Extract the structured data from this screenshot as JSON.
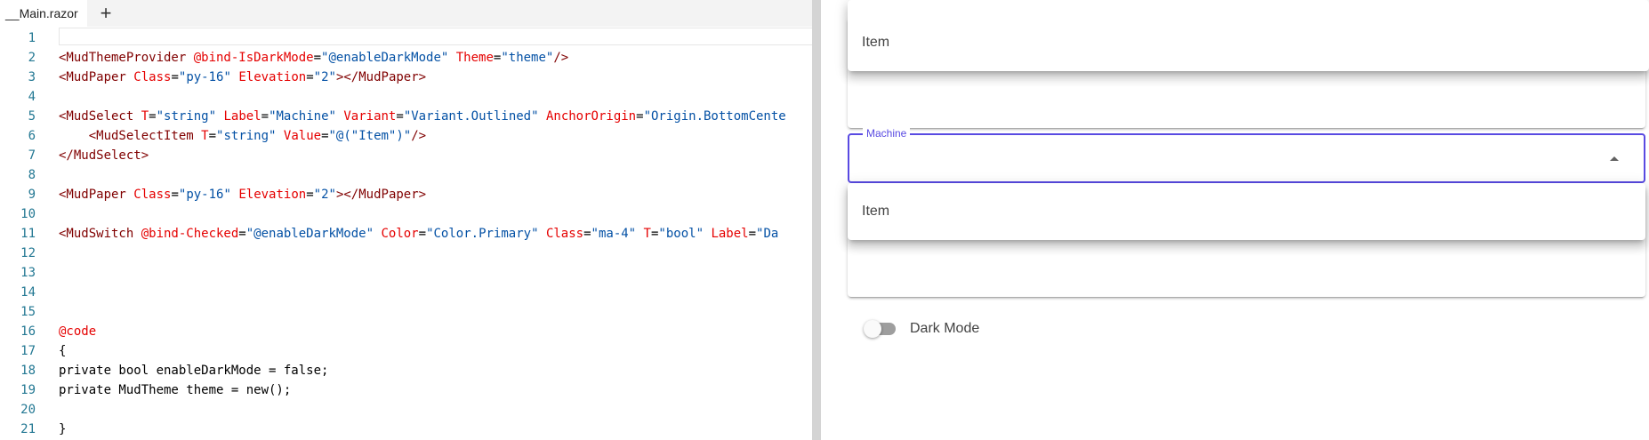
{
  "editor": {
    "tab_label": "__Main.razor",
    "add_tab_symbol": "+",
    "line_numbers": [
      "1",
      "2",
      "3",
      "4",
      "5",
      "6",
      "7",
      "8",
      "9",
      "10",
      "11",
      "12",
      "13",
      "14",
      "15",
      "16",
      "17",
      "18",
      "19",
      "20",
      "21"
    ],
    "lines": [
      [],
      [
        {
          "t": "<MudThemeProvider ",
          "c": "tag"
        },
        {
          "t": "@bind-IsDarkMode",
          "c": "razor"
        },
        {
          "t": "=",
          "c": ""
        },
        {
          "t": "\"@enableDarkMode\"",
          "c": "str"
        },
        {
          "t": " ",
          "c": ""
        },
        {
          "t": "Theme",
          "c": "attr"
        },
        {
          "t": "=",
          "c": ""
        },
        {
          "t": "\"theme\"",
          "c": "str"
        },
        {
          "t": "/>",
          "c": "tag"
        }
      ],
      [
        {
          "t": "<MudPaper ",
          "c": "tag"
        },
        {
          "t": "Class",
          "c": "attr"
        },
        {
          "t": "=",
          "c": ""
        },
        {
          "t": "\"py-16\"",
          "c": "str"
        },
        {
          "t": " ",
          "c": ""
        },
        {
          "t": "Elevation",
          "c": "attr"
        },
        {
          "t": "=",
          "c": ""
        },
        {
          "t": "\"2\"",
          "c": "str"
        },
        {
          "t": "></MudPaper>",
          "c": "tag"
        }
      ],
      [],
      [
        {
          "t": "<MudSelect ",
          "c": "tag"
        },
        {
          "t": "T",
          "c": "attr"
        },
        {
          "t": "=",
          "c": ""
        },
        {
          "t": "\"string\"",
          "c": "str"
        },
        {
          "t": " ",
          "c": ""
        },
        {
          "t": "Label",
          "c": "attr"
        },
        {
          "t": "=",
          "c": ""
        },
        {
          "t": "\"Machine\"",
          "c": "str"
        },
        {
          "t": " ",
          "c": ""
        },
        {
          "t": "Variant",
          "c": "attr"
        },
        {
          "t": "=",
          "c": ""
        },
        {
          "t": "\"Variant.Outlined\"",
          "c": "str"
        },
        {
          "t": " ",
          "c": ""
        },
        {
          "t": "AnchorOrigin",
          "c": "attr"
        },
        {
          "t": "=",
          "c": ""
        },
        {
          "t": "\"Origin.BottomCente",
          "c": "str"
        }
      ],
      [
        {
          "t": "    <MudSelectItem ",
          "c": "tag"
        },
        {
          "t": "T",
          "c": "attr"
        },
        {
          "t": "=",
          "c": ""
        },
        {
          "t": "\"string\"",
          "c": "str"
        },
        {
          "t": " ",
          "c": ""
        },
        {
          "t": "Value",
          "c": "attr"
        },
        {
          "t": "=",
          "c": ""
        },
        {
          "t": "\"@(\"Item\")\"",
          "c": "str"
        },
        {
          "t": "/>",
          "c": "tag"
        }
      ],
      [
        {
          "t": "</MudSelect>",
          "c": "tag"
        }
      ],
      [],
      [
        {
          "t": "<MudPaper ",
          "c": "tag"
        },
        {
          "t": "Class",
          "c": "attr"
        },
        {
          "t": "=",
          "c": ""
        },
        {
          "t": "\"py-16\"",
          "c": "str"
        },
        {
          "t": " ",
          "c": ""
        },
        {
          "t": "Elevation",
          "c": "attr"
        },
        {
          "t": "=",
          "c": ""
        },
        {
          "t": "\"2\"",
          "c": "str"
        },
        {
          "t": "></MudPaper>",
          "c": "tag"
        }
      ],
      [],
      [
        {
          "t": "<MudSwitch ",
          "c": "tag"
        },
        {
          "t": "@bind-Checked",
          "c": "razor"
        },
        {
          "t": "=",
          "c": ""
        },
        {
          "t": "\"@enableDarkMode\"",
          "c": "str"
        },
        {
          "t": " ",
          "c": ""
        },
        {
          "t": "Color",
          "c": "attr"
        },
        {
          "t": "=",
          "c": ""
        },
        {
          "t": "\"Color.Primary\"",
          "c": "str"
        },
        {
          "t": " ",
          "c": ""
        },
        {
          "t": "Class",
          "c": "attr"
        },
        {
          "t": "=",
          "c": ""
        },
        {
          "t": "\"ma-4\"",
          "c": "str"
        },
        {
          "t": " ",
          "c": ""
        },
        {
          "t": "T",
          "c": "attr"
        },
        {
          "t": "=",
          "c": ""
        },
        {
          "t": "\"bool\"",
          "c": "str"
        },
        {
          "t": " ",
          "c": ""
        },
        {
          "t": "Label",
          "c": "attr"
        },
        {
          "t": "=",
          "c": ""
        },
        {
          "t": "\"Da",
          "c": "str"
        }
      ],
      [],
      [],
      [],
      [],
      [
        {
          "t": "@code",
          "c": "razor"
        }
      ],
      [
        {
          "t": "{",
          "c": ""
        }
      ],
      [
        {
          "t": "private bool enableDarkMode = false;",
          "c": ""
        }
      ],
      [
        {
          "t": "private MudTheme theme = new();",
          "c": ""
        }
      ],
      [],
      [
        {
          "t": "}",
          "c": ""
        }
      ]
    ]
  },
  "preview": {
    "popover_top_item": "Item",
    "select_label": "Machine",
    "popover_bottom_item": "Item",
    "switch_label": "Dark Mode",
    "switch_checked": false,
    "accent_color": "#594ae2"
  }
}
